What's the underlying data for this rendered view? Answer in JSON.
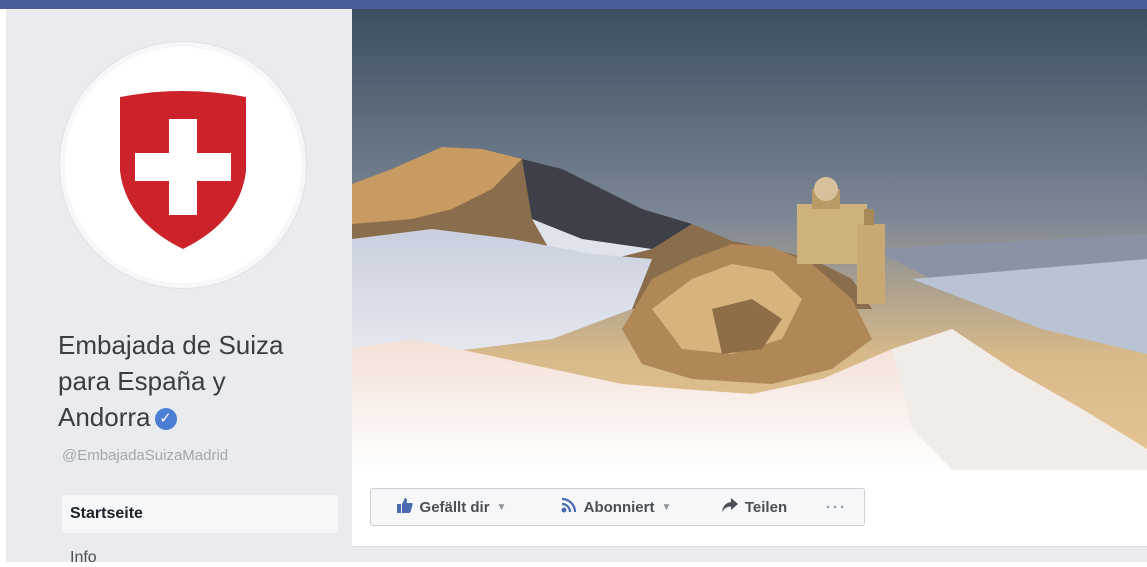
{
  "page": {
    "name_lines": [
      "Embajada de Suiza",
      "para España y",
      "Andorra"
    ],
    "verified_icon": "check",
    "handle": "@EmbajadaSuizaMadrid"
  },
  "nav": {
    "items": [
      {
        "label": "Startseite",
        "active": true
      },
      {
        "label": "Info",
        "active": false
      }
    ]
  },
  "actions": {
    "like": {
      "label": "Gefällt dir",
      "icon": "thumbs-up-icon"
    },
    "subscribe": {
      "label": "Abonniert",
      "icon": "rss-icon"
    },
    "share": {
      "label": "Teilen",
      "icon": "share-arrow-icon"
    },
    "more": {
      "label": "···"
    }
  },
  "colors": {
    "accent": "#4a5f9a",
    "swiss_red": "#cc2229",
    "verified": "#4c7fd4"
  }
}
